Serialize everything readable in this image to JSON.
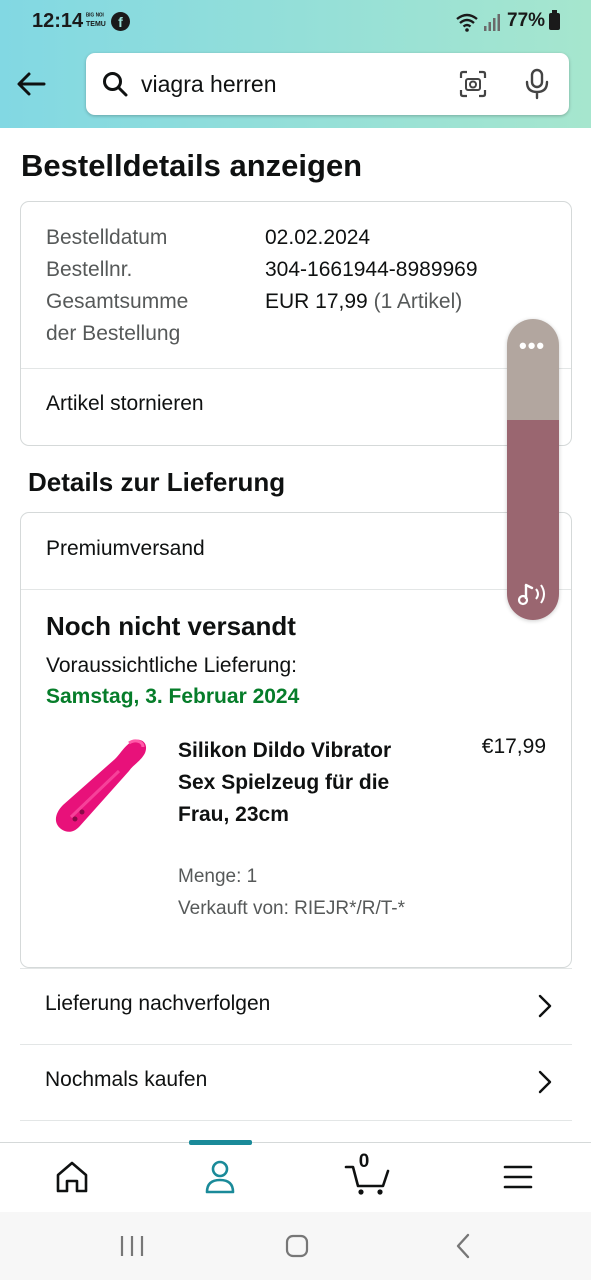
{
  "status_bar": {
    "time": "12:14",
    "mini_badge": "ᴮᴵᴳ ᴺᴼᴵ TEMU",
    "facebook_glyph": "f",
    "battery_percent": "77%",
    "icons": [
      "facebook-icon",
      "wifi-icon",
      "signal-icon",
      "battery-icon"
    ]
  },
  "header": {
    "search_value": "viagra herren",
    "icons": [
      "back-arrow-icon",
      "search-icon",
      "camera-scan-icon",
      "microphone-icon"
    ]
  },
  "page_title": "Bestelldetails anzeigen",
  "order_summary": {
    "date_label": "Bestelldatum",
    "date_value": "02.02.2024",
    "number_label": "Bestellnr.",
    "number_value": "304-1661944-8989969",
    "total_label_line1": "Gesamtsumme",
    "total_label_line2": "der Bestellung",
    "total_value": "EUR 17,99",
    "total_items": "(1 Artikel)",
    "cancel_label": "Artikel stornieren"
  },
  "delivery": {
    "section_title": "Details zur Lieferung",
    "shipping_method": "Premiumversand",
    "status": "Noch nicht versandt",
    "eta_label": "Voraussichtliche Lieferung:",
    "eta_date": "Samstag, 3. Februar 2024",
    "item": {
      "name": "Silikon Dildo Vibrator Sex Spielzeug für die Frau, 23cm",
      "price": "€17,99",
      "quantity": "Menge: 1",
      "seller": "Verkauft von: RIEJR*/R/T-*",
      "accent_color": "#e8117a"
    }
  },
  "actions": [
    {
      "label": "Lieferung nachverfolgen"
    },
    {
      "label": "Nochmals kaufen"
    }
  ],
  "floating_widget": {
    "dots": "•••",
    "colors": {
      "top": "#b2a69f",
      "bottom": "#9a6670"
    }
  },
  "bottom_nav": {
    "active": "account",
    "cart_count": "0",
    "items": [
      "home-icon",
      "account-icon",
      "cart-icon",
      "menu-icon"
    ],
    "accent": "#1a8a99"
  },
  "system_nav": [
    "recents-icon",
    "home-circle-icon",
    "back-chevron-icon"
  ]
}
